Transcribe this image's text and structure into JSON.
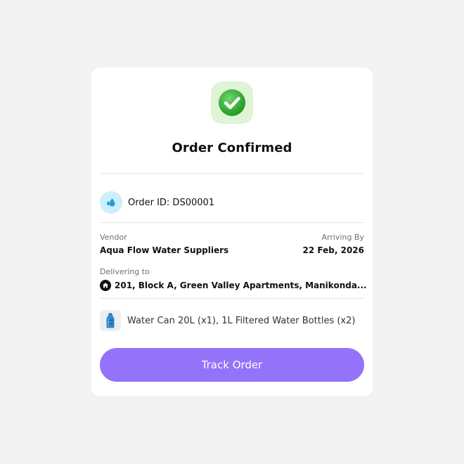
{
  "header": {
    "icon": "check-circle-icon",
    "title": "Order Confirmed"
  },
  "order": {
    "icon": "water-drop-icon",
    "id_text": "Order ID: DS00001"
  },
  "vendor": {
    "label": "Vendor",
    "value": "Aqua Flow Water Suppliers"
  },
  "arrival": {
    "label": "Arriving By",
    "value": "22 Feb, 2026"
  },
  "delivery": {
    "label": "Delivering to",
    "icon": "home-icon",
    "address": "201, Block A, Green Valley Apartments, Manikonda..."
  },
  "items": {
    "icon": "water-bottle-icon",
    "text": "Water Can 20L (x1), 1L Filtered Water Bottles (x2)"
  },
  "actions": {
    "track_label": "Track Order"
  },
  "colors": {
    "accent": "#9472fa",
    "success": "#2fae2f",
    "drop_blue": "#1f9fd9"
  }
}
